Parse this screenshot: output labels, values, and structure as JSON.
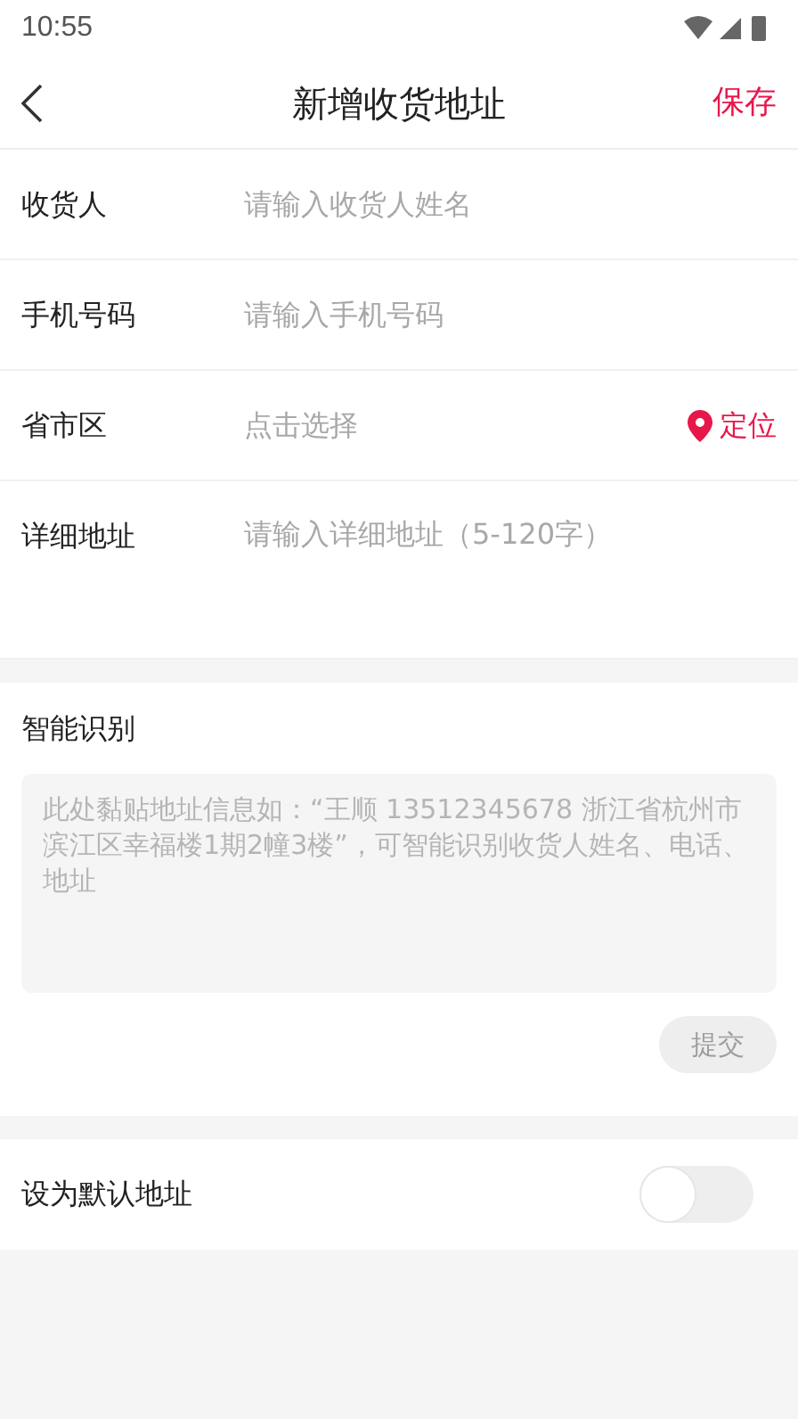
{
  "status_bar": {
    "time": "10:55"
  },
  "header": {
    "title": "新增收货地址",
    "action": "保存"
  },
  "form": {
    "fields": [
      {
        "kind": "text",
        "label": "收货人",
        "placeholder": "请输入收货人姓名"
      },
      {
        "kind": "text",
        "label": "手机号码",
        "placeholder": "请输入手机号码"
      },
      {
        "kind": "picker",
        "label": "省市区",
        "placeholder": "点击选择",
        "action": "定位"
      },
      {
        "kind": "textarea",
        "label": "详细地址",
        "placeholder": "请输入详细地址（5-120字）"
      }
    ]
  },
  "smart_recognition": {
    "title": "智能识别",
    "placeholder": "此处黏贴地址信息如：“王顺 13512345678 浙江省杭州市滨江区幸福楼1期2幢3楼”，可智能识别收货人姓名、电话、地址",
    "submit": {
      "label": "提交",
      "disabled": true
    }
  },
  "default_address": {
    "label": "设为默认地址",
    "on": false
  }
}
